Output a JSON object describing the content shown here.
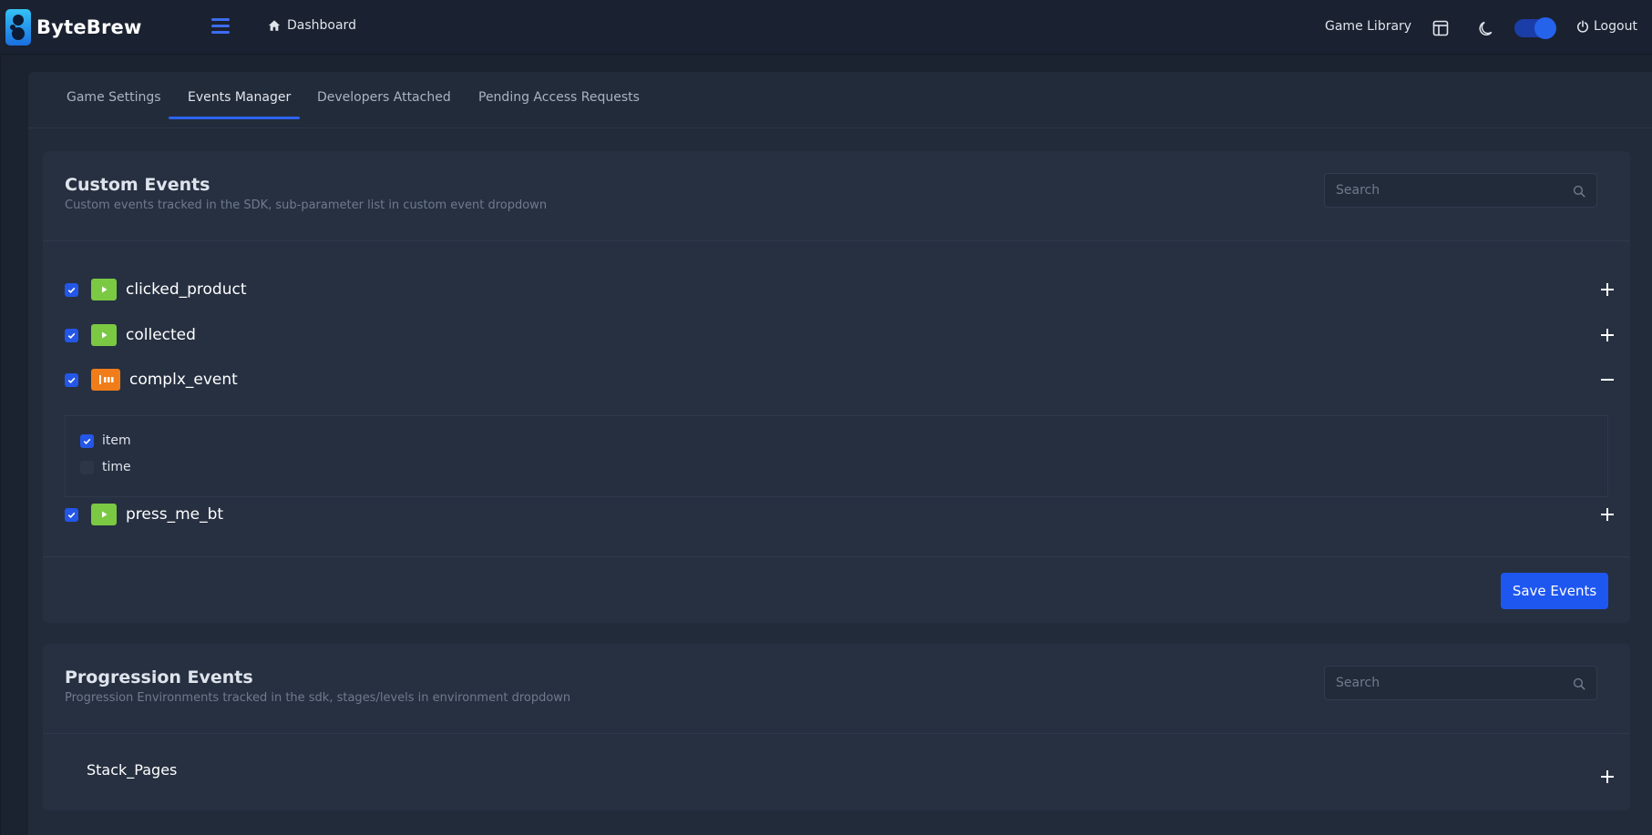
{
  "app": {
    "brand": "ByteBrew",
    "nav": {
      "dashboard": "Dashboard",
      "game_library": "Game Library",
      "logout": "Logout"
    },
    "dark_mode_on": true
  },
  "tabs": [
    {
      "label": "Game Settings",
      "active": false
    },
    {
      "label": "Events Manager",
      "active": true
    },
    {
      "label": "Developers Attached",
      "active": false
    },
    {
      "label": "Pending Access Requests",
      "active": false
    }
  ],
  "custom_events": {
    "title": "Custom Events",
    "subtitle": "Custom events tracked in the SDK, sub-parameter list in custom event dropdown",
    "search_placeholder": "Search",
    "events": [
      {
        "name": "clicked_product",
        "checked": true,
        "badge": "play",
        "expanded": false
      },
      {
        "name": "collected",
        "checked": true,
        "badge": "play",
        "expanded": false
      },
      {
        "name": "complx_event",
        "checked": true,
        "badge": "params",
        "expanded": true,
        "params": [
          {
            "name": "item",
            "checked": true
          },
          {
            "name": "time",
            "checked": false
          }
        ]
      },
      {
        "name": "press_me_bt",
        "checked": true,
        "badge": "play",
        "expanded": false
      }
    ],
    "save_label": "Save Events"
  },
  "progression_events": {
    "title": "Progression Events",
    "subtitle": "Progression Environments tracked in the sdk, stages/levels in environment dropdown",
    "search_placeholder": "Search",
    "environments": [
      {
        "name": "Stack_Pages",
        "expanded": false
      }
    ]
  },
  "colors": {
    "accent": "#2456e8",
    "badge_play": "#7bc943",
    "badge_params": "#f07d1a",
    "background": "#1b2230"
  }
}
